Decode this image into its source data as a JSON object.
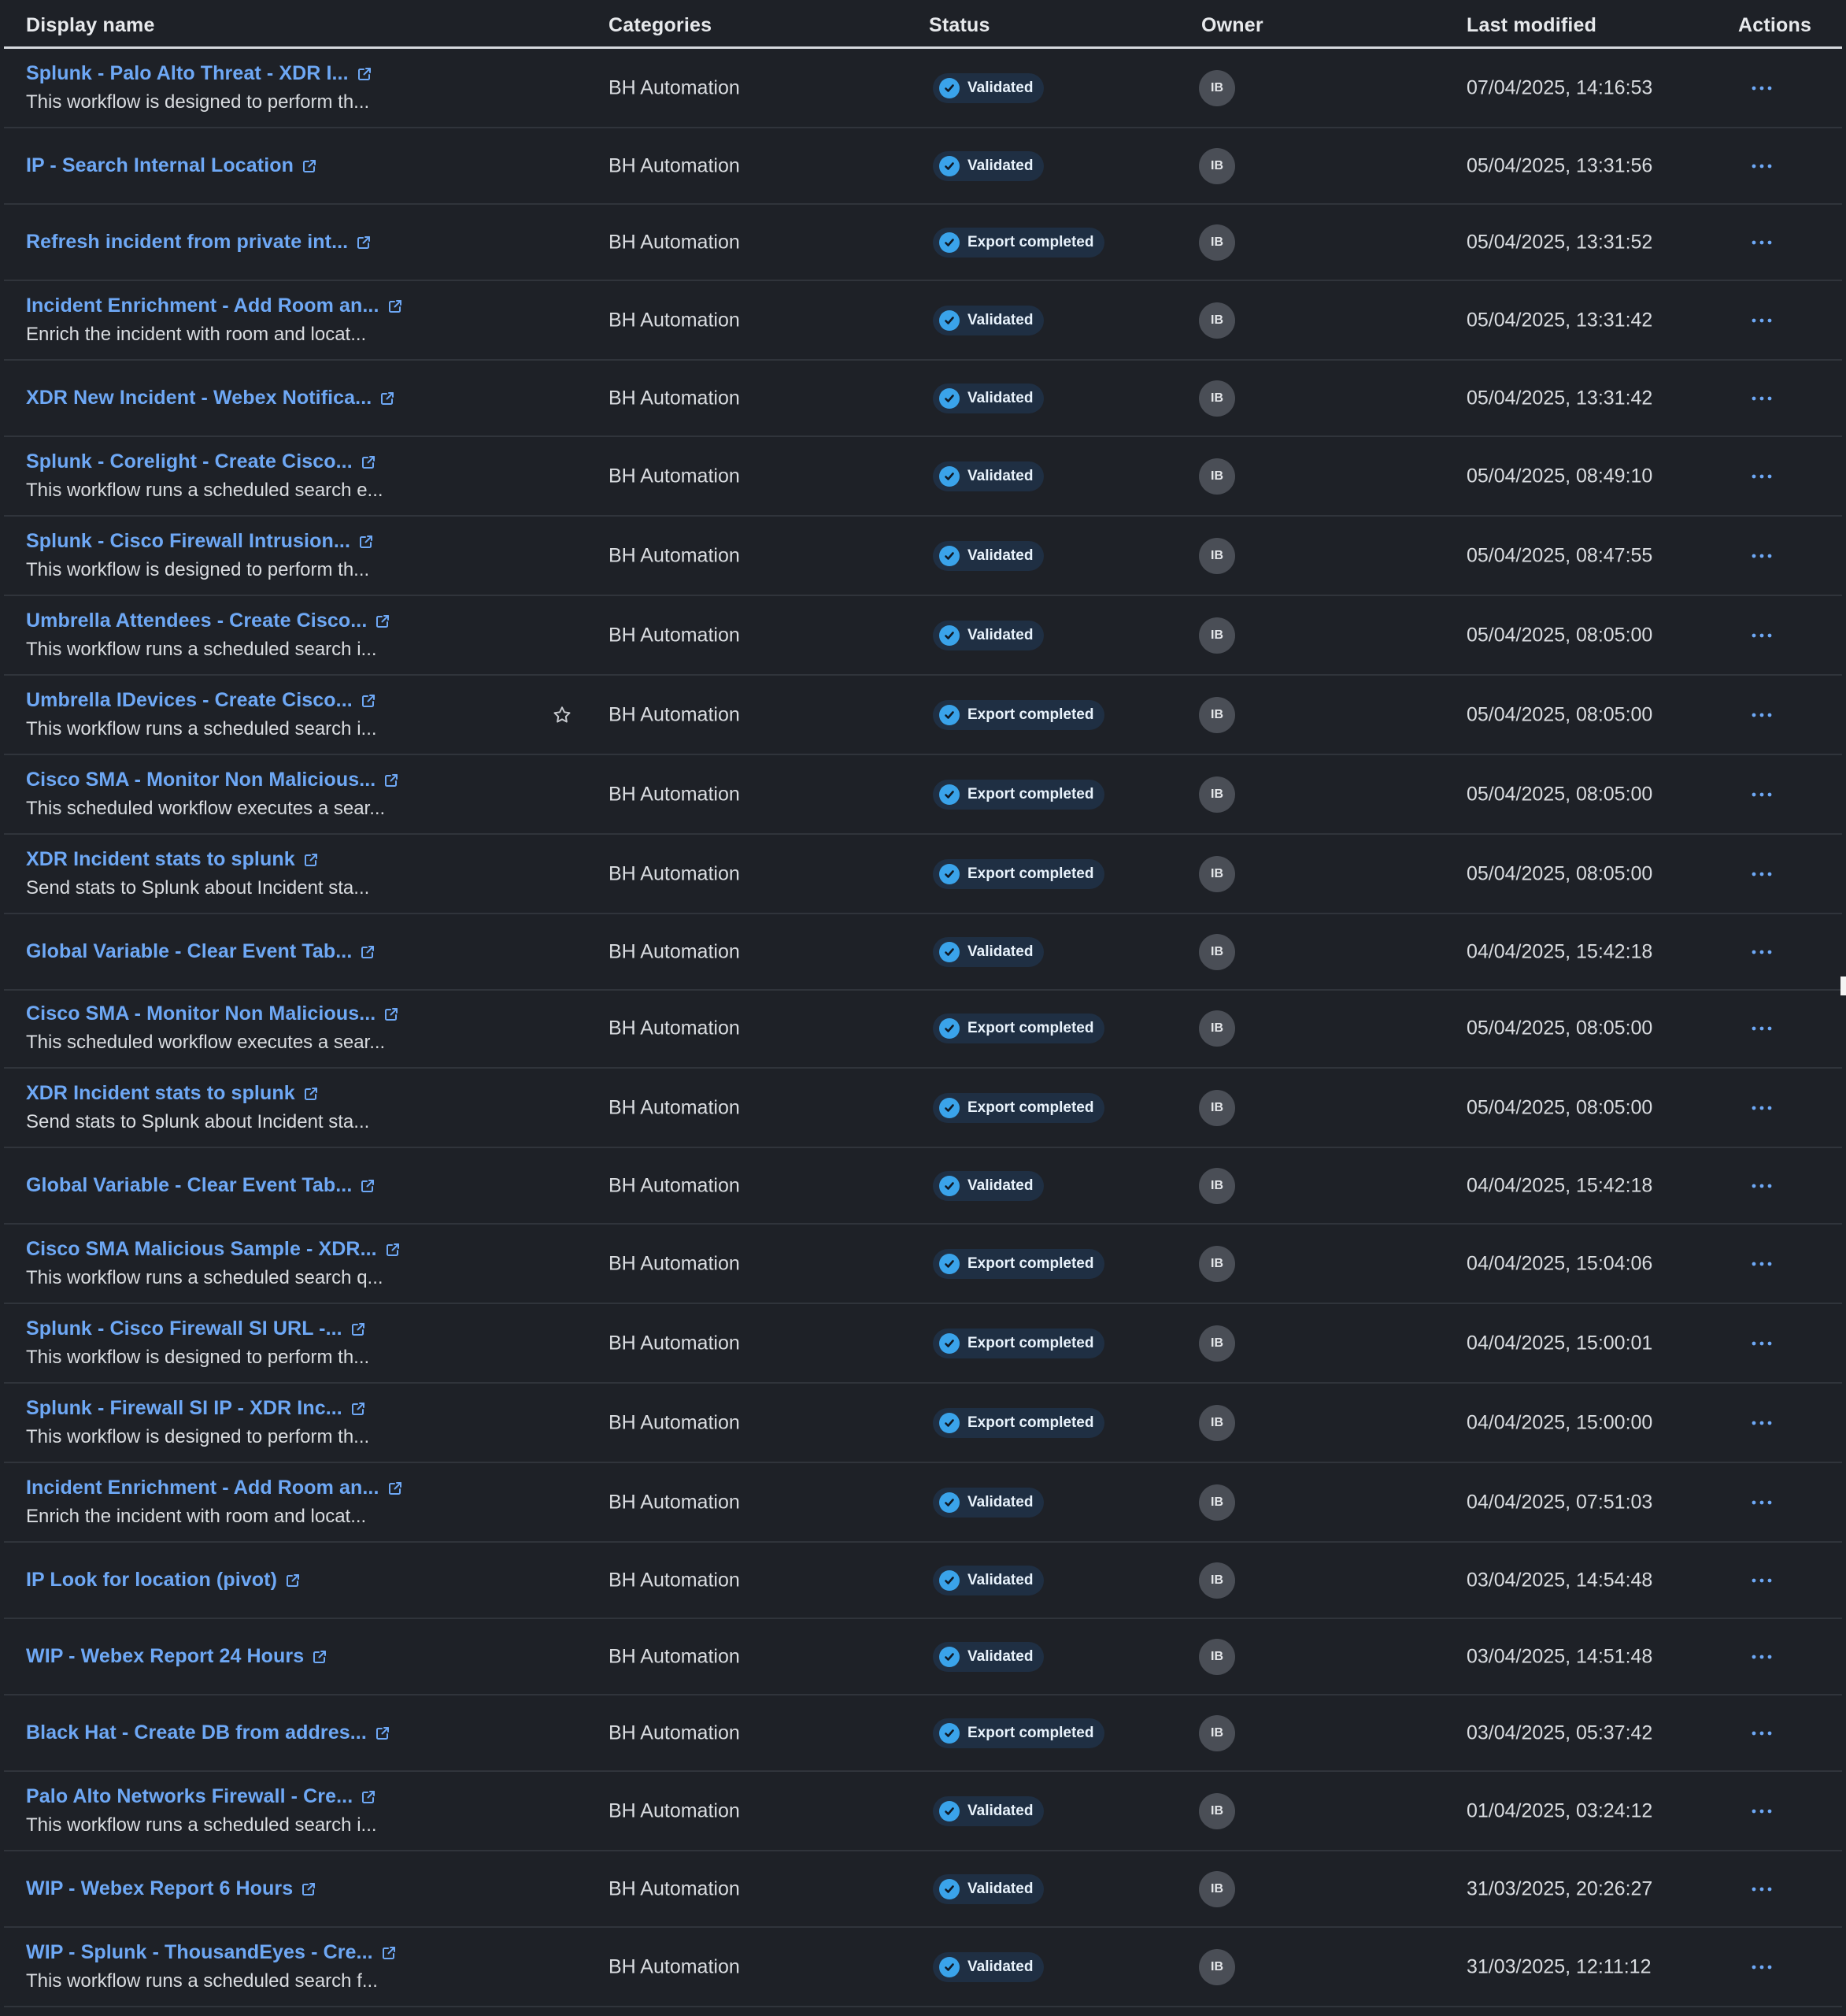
{
  "header": {
    "display_name": "Display name",
    "categories": "Categories",
    "status": "Status",
    "owner": "Owner",
    "last_modified": "Last modified",
    "actions": "Actions"
  },
  "icons": {
    "external_link": "external-link-icon",
    "status_check": "check-circle-icon",
    "actions": "ellipsis-icon",
    "favorite": "star-icon"
  },
  "colors": {
    "background": "#1e2127",
    "link": "#6ea8f5",
    "badge_bg": "#1f2f43",
    "check": "#3aa3ea",
    "avatar": "#4a4e56"
  },
  "rows_top": [
    {
      "title": "Splunk - Palo Alto Threat - XDR I...",
      "desc": "This workflow is designed to perform th...",
      "category": "BH Automation",
      "status": "Validated",
      "owner": "IB",
      "modified": "07/04/2025, 14:16:53"
    },
    {
      "title": "IP - Search Internal Location",
      "desc": "",
      "category": "BH Automation",
      "status": "Validated",
      "owner": "IB",
      "modified": "05/04/2025, 13:31:56"
    },
    {
      "title": "Refresh incident from private int...",
      "desc": "",
      "category": "BH Automation",
      "status": "Export completed",
      "owner": "IB",
      "modified": "05/04/2025, 13:31:52"
    },
    {
      "title": "Incident Enrichment - Add Room an...",
      "desc": "Enrich the incident with room and locat...",
      "category": "BH Automation",
      "status": "Validated",
      "owner": "IB",
      "modified": "05/04/2025, 13:31:42"
    },
    {
      "title": "XDR New Incident - Webex Notifica...",
      "desc": "",
      "category": "BH Automation",
      "status": "Validated",
      "owner": "IB",
      "modified": "05/04/2025, 13:31:42"
    },
    {
      "title": "Splunk - Corelight - Create Cisco...",
      "desc": "This workflow runs a scheduled search e...",
      "category": "BH Automation",
      "status": "Validated",
      "owner": "IB",
      "modified": "05/04/2025, 08:49:10"
    },
    {
      "title": "Splunk - Cisco Firewall Intrusion...",
      "desc": "This workflow is designed to perform th...",
      "category": "BH Automation",
      "status": "Validated",
      "owner": "IB",
      "modified": "05/04/2025, 08:47:55"
    },
    {
      "title": "Umbrella Attendees - Create Cisco...",
      "desc": "This workflow runs a scheduled search i...",
      "category": "BH Automation",
      "status": "Validated",
      "owner": "IB",
      "modified": "05/04/2025, 08:05:00"
    },
    {
      "title": "Umbrella IDevices - Create Cisco...",
      "desc": "This workflow runs a scheduled search i...",
      "category": "BH Automation",
      "status": "Export completed",
      "owner": "IB",
      "modified": "05/04/2025, 08:05:00"
    },
    {
      "title": "Cisco SMA - Monitor Non Malicious...",
      "desc": "This scheduled workflow executes a sear...",
      "category": "BH Automation",
      "status": "Export completed",
      "owner": "IB",
      "modified": "05/04/2025, 08:05:00"
    },
    {
      "title": "XDR Incident stats to splunk",
      "desc": "Send stats to Splunk about Incident sta...",
      "category": "BH Automation",
      "status": "Export completed",
      "owner": "IB",
      "modified": "05/04/2025, 08:05:00"
    },
    {
      "title": "Global Variable - Clear Event Tab...",
      "desc": "",
      "category": "BH Automation",
      "status": "Validated",
      "owner": "IB",
      "modified": "04/04/2025, 15:42:18"
    }
  ],
  "rows_bottom": [
    {
      "title": "Cisco SMA - Monitor Non Malicious...",
      "desc": "This scheduled workflow executes a sear...",
      "category": "BH Automation",
      "status": "Export completed",
      "owner": "IB",
      "modified": "05/04/2025, 08:05:00"
    },
    {
      "title": "XDR Incident stats to splunk",
      "desc": "Send stats to Splunk about Incident sta...",
      "category": "BH Automation",
      "status": "Export completed",
      "owner": "IB",
      "modified": "05/04/2025, 08:05:00"
    },
    {
      "title": "Global Variable - Clear Event Tab...",
      "desc": "",
      "category": "BH Automation",
      "status": "Validated",
      "owner": "IB",
      "modified": "04/04/2025, 15:42:18"
    },
    {
      "title": "Cisco SMA Malicious Sample - XDR...",
      "desc": "This workflow runs a scheduled search q...",
      "category": "BH Automation",
      "status": "Export completed",
      "owner": "IB",
      "modified": "04/04/2025, 15:04:06"
    },
    {
      "title": "Splunk - Cisco Firewall SI URL -...",
      "desc": "This workflow is designed to perform th...",
      "category": "BH Automation",
      "status": "Export completed",
      "owner": "IB",
      "modified": "04/04/2025, 15:00:01"
    },
    {
      "title": "Splunk - Firewall SI IP - XDR Inc...",
      "desc": "This workflow is designed to perform th...",
      "category": "BH Automation",
      "status": "Export completed",
      "owner": "IB",
      "modified": "04/04/2025, 15:00:00"
    },
    {
      "title": "Incident Enrichment - Add Room an...",
      "desc": "Enrich the incident with room and locat...",
      "category": "BH Automation",
      "status": "Validated",
      "owner": "IB",
      "modified": "04/04/2025, 07:51:03"
    },
    {
      "title": "IP Look for location (pivot)",
      "desc": "",
      "category": "BH Automation",
      "status": "Validated",
      "owner": "IB",
      "modified": "03/04/2025, 14:54:48"
    },
    {
      "title": "WIP - Webex Report 24 Hours",
      "desc": "",
      "category": "BH Automation",
      "status": "Validated",
      "owner": "IB",
      "modified": "03/04/2025, 14:51:48"
    },
    {
      "title": "Black Hat - Create DB from addres...",
      "desc": "",
      "category": "BH Automation",
      "status": "Export completed",
      "owner": "IB",
      "modified": "03/04/2025, 05:37:42"
    },
    {
      "title": "Palo Alto Networks Firewall - Cre...",
      "desc": "This workflow runs a scheduled search i...",
      "category": "BH Automation",
      "status": "Validated",
      "owner": "IB",
      "modified": "01/04/2025, 03:24:12"
    },
    {
      "title": "WIP - Webex Report 6 Hours",
      "desc": "",
      "category": "BH Automation",
      "status": "Validated",
      "owner": "IB",
      "modified": "31/03/2025, 20:26:27"
    },
    {
      "title": "WIP - Splunk - ThousandEyes - Cre...",
      "desc": "This workflow runs a scheduled search f...",
      "category": "BH Automation",
      "status": "Validated",
      "owner": "IB",
      "modified": "31/03/2025, 12:11:12"
    }
  ]
}
